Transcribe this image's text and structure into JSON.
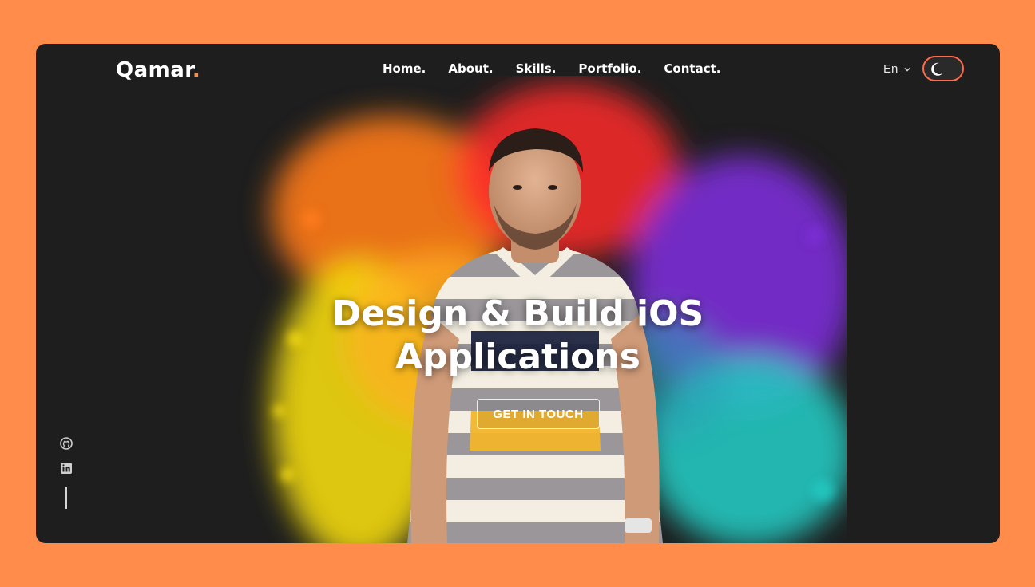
{
  "brand": {
    "name": "Qamar",
    "dot": ".",
    "accent": "#FF8C4B"
  },
  "nav": {
    "items": [
      "Home.",
      "About.",
      "Skills.",
      "Portfolio.",
      "Contact."
    ]
  },
  "language": {
    "selected": "En"
  },
  "theme_toggle": {
    "icon": "moon-icon",
    "border_color": "#FF6B4A"
  },
  "hero": {
    "title_line1": "Design & Build iOS",
    "title_line2": "Applications",
    "cta_label": "GET IN TOUCH"
  },
  "social": {
    "icons": [
      "github-icon",
      "linkedin-icon"
    ]
  },
  "colors": {
    "page_bg": "#FF8C4B",
    "frame_bg": "#1e1e1e",
    "splash": [
      "#FF7A1A",
      "#FF2A2A",
      "#F2D90A",
      "#7B2FD6",
      "#24C7C0"
    ]
  }
}
